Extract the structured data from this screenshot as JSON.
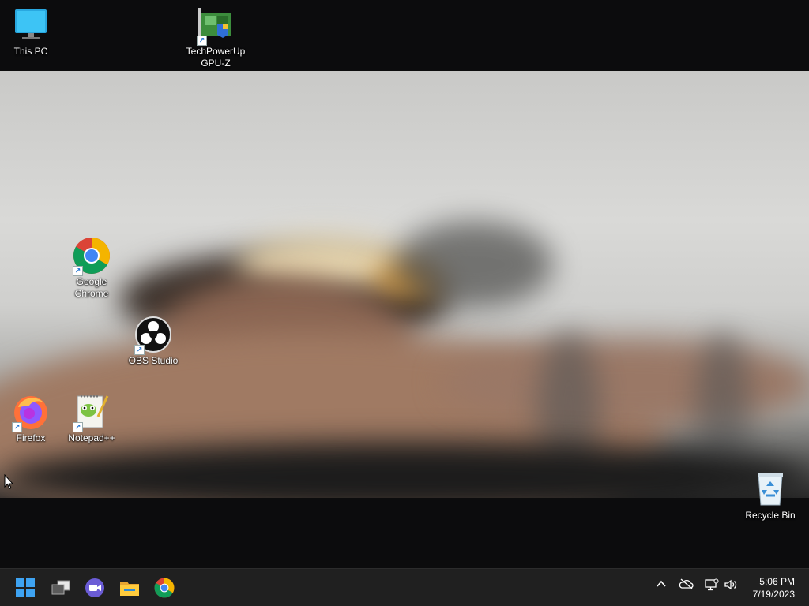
{
  "desktop": {
    "icons": [
      {
        "label": "This PC"
      },
      {
        "label": "TechPowerUp GPU-Z"
      },
      {
        "label": "Google Chrome"
      },
      {
        "label": "OBS Studio"
      },
      {
        "label": "Firefox"
      },
      {
        "label": "Notepad++"
      },
      {
        "label": "Recycle Bin"
      }
    ]
  },
  "taskbar": {
    "apps": [
      "start-icon",
      "task-view-icon",
      "chat-icon",
      "file-explorer-icon",
      "chrome-icon"
    ],
    "tray": [
      "chevron-up-icon",
      "onedrive-offline-icon",
      "network-icon",
      "volume-icon"
    ],
    "clock": {
      "time": "5:06 PM",
      "date": "7/19/2023"
    }
  },
  "colors": {
    "taskbar": "#202020",
    "accent": "#0078d4"
  }
}
